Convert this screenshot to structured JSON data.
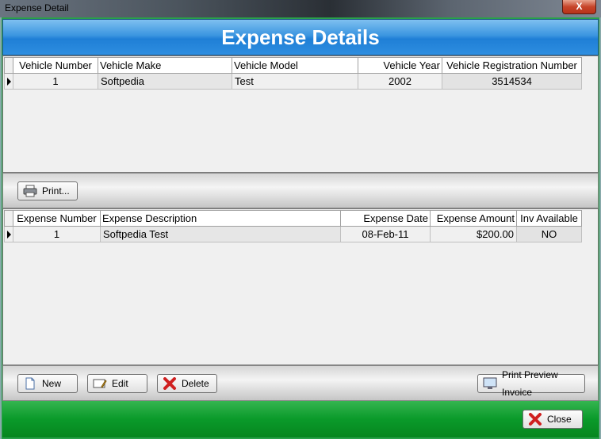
{
  "window": {
    "title": "Expense Detail",
    "close_glyph": "X"
  },
  "banner": {
    "title": "Expense Details"
  },
  "vehicles": {
    "columns": [
      "Vehicle Number",
      "Vehicle Make",
      "Vehicle Model",
      "Vehicle Year",
      "Vehicle Registration Number"
    ],
    "rows": [
      {
        "number": "1",
        "make": "Softpedia",
        "model": "Test",
        "year": "2002",
        "registration": "3514534"
      }
    ]
  },
  "toolbar": {
    "print_label": "Print..."
  },
  "expenses": {
    "columns": [
      "Expense Number",
      "Expense Description",
      "Expense Date",
      "Expense Amount",
      "Inv Available"
    ],
    "rows": [
      {
        "number": "1",
        "description": "Softpedia Test",
        "date": "08-Feb-11",
        "amount": "$200.00",
        "inv": "NO"
      }
    ]
  },
  "actions": {
    "new_label": "New",
    "edit_label": "Edit",
    "delete_label": "Delete",
    "print_preview_label": "Print Preview Invoice",
    "close_label": "Close"
  },
  "colors": {
    "banner": "#2e8ee0",
    "footer": "#0a9a2a",
    "delete_red": "#d02020"
  }
}
